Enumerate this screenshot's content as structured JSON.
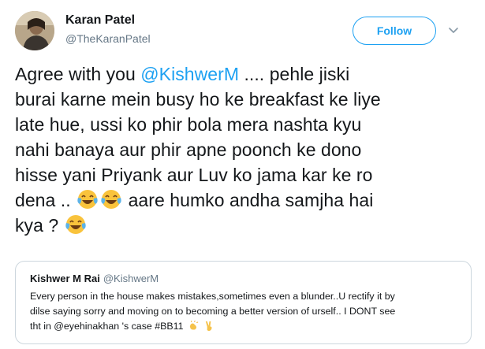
{
  "author": {
    "name": "Karan Patel",
    "handle": "@TheKaranPatel",
    "avatar_icon": "profile-photo"
  },
  "follow_label": "Follow",
  "menu_icon": "chevron-down-icon",
  "accent_color": "#1da1f2",
  "tweet": {
    "line1_a": "Agree with you ",
    "mention": "@KishwerM",
    "line1_b": " .... pehle jiski",
    "line2": "burai karne mein busy ho ke breakfast ke liye",
    "line3": "late hue, ussi ko phir bola mera nashta kyu",
    "line4": "nahi banaya aur phir apne poonch ke dono",
    "line5": "hisse yani Priyank aur Luv ko jama kar ke ro",
    "line6_a": "dena .. ",
    "line6_b": " aare humko andha samjha hai",
    "line7_a": "kya ? ",
    "emoji_name": "face-with-tears-of-joy-icon"
  },
  "quote": {
    "name": "Kishwer M Rai",
    "handle": "@KishwerM",
    "line1": "Every person in the house makes mistakes,sometimes even a blunder..U rectify it by",
    "line2": "dilse saying sorry and moving on to becoming a better version of urself.. I DONT see",
    "line3": "tht in @eyehinakhan 's case #BB11",
    "trailing_emojis": [
      "clapping-hands-icon",
      "victory-hand-icon"
    ]
  }
}
